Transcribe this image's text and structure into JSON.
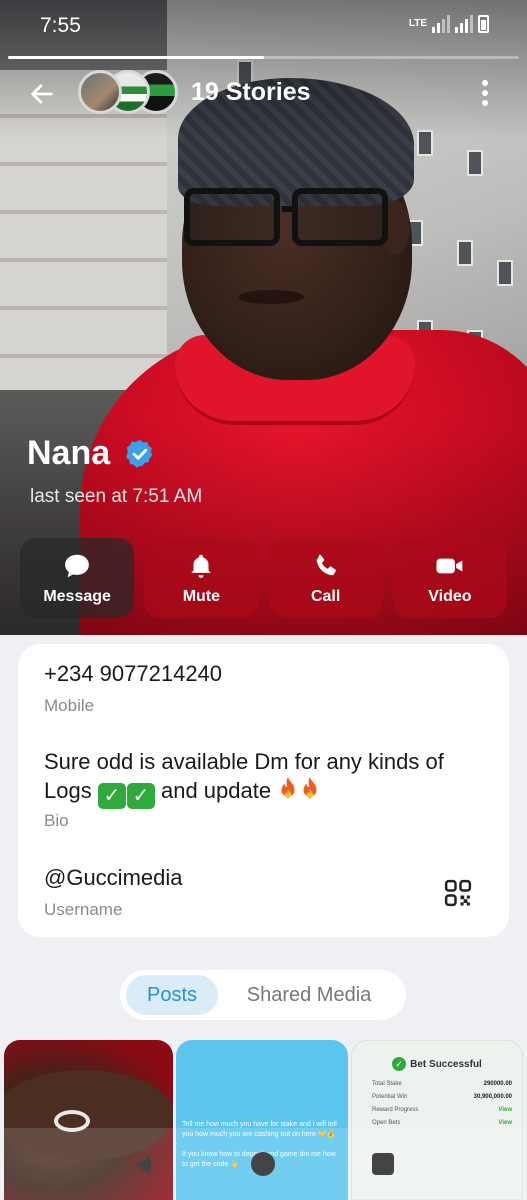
{
  "status_bar": {
    "time": "7:55",
    "network": "LTE",
    "battery_icon": "battery-icon"
  },
  "story_progress": 0.5,
  "header": {
    "stories_title": "19 Stories",
    "back_icon": "arrow-left-icon",
    "more_icon": "more-vertical-icon"
  },
  "profile": {
    "name": "Nana",
    "verified": true,
    "last_seen": "last seen at 7:51 AM"
  },
  "actions": [
    {
      "label": "Message",
      "icon": "chat-bubble-icon"
    },
    {
      "label": "Mute",
      "icon": "bell-icon"
    },
    {
      "label": "Call",
      "icon": "phone-icon"
    },
    {
      "label": "Video",
      "icon": "video-camera-icon"
    }
  ],
  "info": {
    "phone": "+234 9077214240",
    "phone_label": "Mobile",
    "bio_line1": "Sure odd is available Dm for any kinds of",
    "bio_line2_start": "Logs",
    "bio_line2_end": "and update",
    "bio_label": "Bio",
    "username": "@Guccimedia",
    "username_label": "Username"
  },
  "tabs": {
    "posts": "Posts",
    "shared_media": "Shared Media",
    "active": "Posts"
  },
  "posts": {
    "post2_text1": "Tell me how much you have for stake and i will tell you how much you are cashing out on here 🤝💰",
    "post2_text2": "If you know how to deposit and game dm me how to get the code 👆",
    "bet_title": "Bet Successful",
    "bet_rows": [
      {
        "label": "Total Stake",
        "value": "290000.00"
      },
      {
        "label": "Potential Win",
        "value": "30,900,000.00"
      },
      {
        "label": "Reward Progress",
        "value": "View"
      },
      {
        "label": "Open Bets",
        "value": "View"
      }
    ]
  },
  "colors": {
    "accent": "#2a8fd4",
    "verified": "#3aa0e8",
    "shirt_red": "#cc0c22"
  }
}
